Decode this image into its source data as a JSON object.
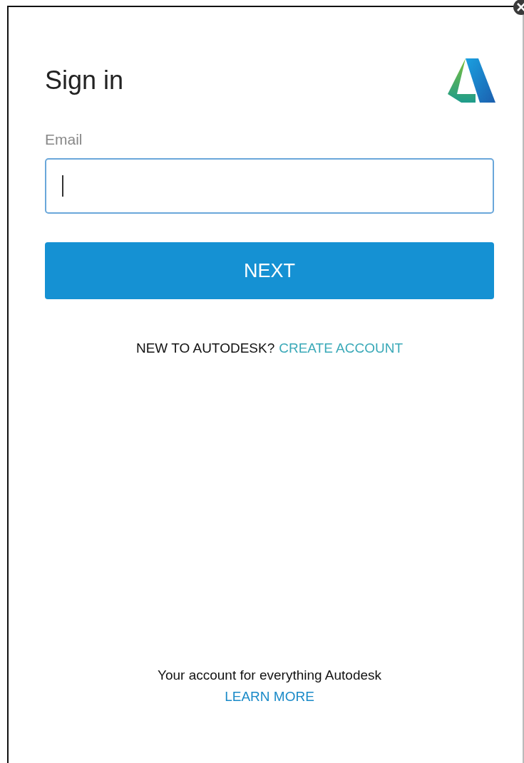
{
  "title": "Sign in",
  "email": {
    "label": "Email"
  },
  "next_button": "NEXT",
  "signup": {
    "prompt": "NEW TO AUTODESK?",
    "link": "CREATE ACCOUNT"
  },
  "footer": {
    "tagline": "Your account for everything Autodesk",
    "link": "LEARN MORE"
  }
}
